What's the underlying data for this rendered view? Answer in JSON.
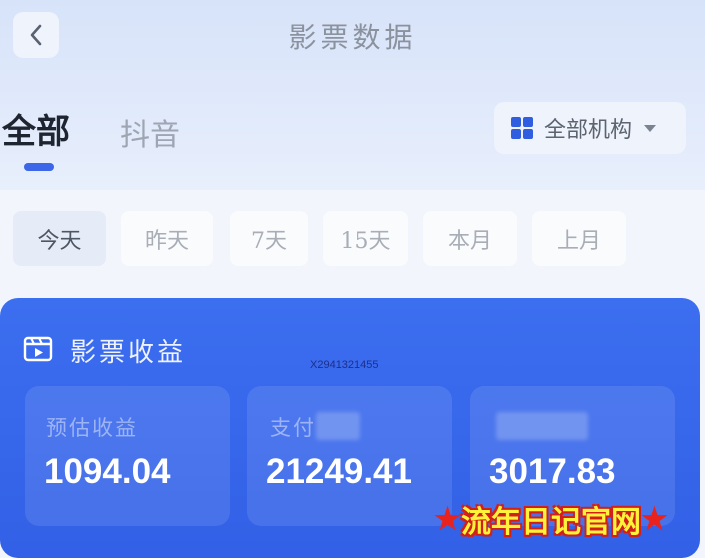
{
  "header": {
    "title": "影票数据",
    "back_icon": "chevron-left-icon"
  },
  "tabs": [
    {
      "label": "全部",
      "active": true
    },
    {
      "label": "抖音",
      "active": false
    }
  ],
  "org_select": {
    "label": "全部机构",
    "icon": "grid-icon"
  },
  "date_filters": [
    {
      "label": "今天",
      "active": true
    },
    {
      "label": "昨天",
      "active": false
    },
    {
      "label": "7天",
      "active": false
    },
    {
      "label": "15天",
      "active": false
    },
    {
      "label": "本月",
      "active": false
    },
    {
      "label": "上月",
      "active": false
    }
  ],
  "card": {
    "title": "影票收益",
    "icon": "film-icon",
    "metrics": [
      {
        "label": "预估收益",
        "value": "1094.04"
      },
      {
        "label": "支付",
        "value": "21249.41"
      },
      {
        "label": "",
        "value": "3017.83"
      }
    ]
  },
  "watermark": {
    "id": "X2941321455",
    "site": "流年日记官网",
    "star": "★"
  },
  "colors": {
    "accent": "#3b67e8",
    "card": "#3563ea",
    "stamp_text": "#fff33a",
    "stamp_outline": "#d0201c"
  }
}
